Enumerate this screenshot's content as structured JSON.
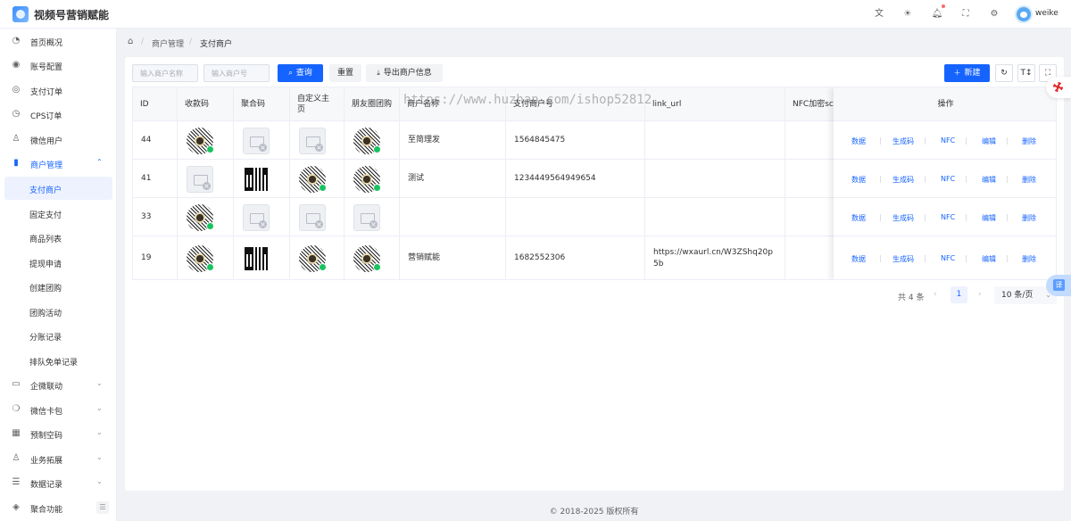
{
  "app": {
    "title": "视频号营销赋能"
  },
  "header": {
    "icons": [
      "translate-icon",
      "theme-icon",
      "bell-icon",
      "fullscreen-icon",
      "settings-icon"
    ],
    "username": "weike"
  },
  "sidebar": {
    "items": [
      {
        "label": "首页概况",
        "icon": "dashboard-icon"
      },
      {
        "label": "账号配置",
        "icon": "account-icon"
      },
      {
        "label": "支付订单",
        "icon": "payment-icon"
      },
      {
        "label": "CPS订单",
        "icon": "clock-icon"
      },
      {
        "label": "微信用户",
        "icon": "user-icon"
      },
      {
        "label": "商户管理",
        "icon": "chart-icon",
        "expanded": true
      }
    ],
    "sub_items": [
      {
        "label": "支付商户",
        "active": true
      },
      {
        "label": "固定支付"
      },
      {
        "label": "商品列表"
      },
      {
        "label": "提现申请"
      },
      {
        "label": "创建团购"
      },
      {
        "label": "团购活动"
      },
      {
        "label": "分账记录"
      },
      {
        "label": "排队免单记录"
      }
    ],
    "more_items": [
      {
        "label": "企微联动",
        "icon": "box-icon"
      },
      {
        "label": "微信卡包",
        "icon": "wechat-icon"
      },
      {
        "label": "预制空码",
        "icon": "qrcode-icon"
      },
      {
        "label": "业务拓展",
        "icon": "users-icon"
      },
      {
        "label": "数据记录",
        "icon": "list-icon"
      },
      {
        "label": "聚合功能",
        "icon": "grid-icon"
      }
    ]
  },
  "breadcrumb": {
    "home_icon": "home-icon",
    "level1": "商户管理",
    "level2": "支付商户",
    "separator": "/"
  },
  "toolbar": {
    "name_placeholder": "输入商户名称",
    "number_placeholder": "输入商户号",
    "search_label": "查询",
    "reset_label": "重置",
    "export_label": "导出商户信息",
    "new_label": "新建"
  },
  "table": {
    "headers": [
      "ID",
      "收款码",
      "聚合码",
      "自定义主页",
      "朋友圈团购",
      "商户名称",
      "支付商户号",
      "link_url",
      "NFC加密sc",
      "操作"
    ],
    "rows": [
      {
        "id": "44",
        "images": [
          "wechat",
          "broken",
          "broken",
          "wechat"
        ],
        "name": "至简理发",
        "mch_no": "1564845475",
        "link_url": ""
      },
      {
        "id": "41",
        "images": [
          "broken",
          "square",
          "wechat",
          "wechat"
        ],
        "name": "测试",
        "mch_no": "1234449564949654",
        "link_url": ""
      },
      {
        "id": "33",
        "images": [
          "wechat",
          "broken",
          "broken",
          "broken"
        ],
        "name": "",
        "mch_no": "",
        "link_url": ""
      },
      {
        "id": "19",
        "images": [
          "wechat",
          "square",
          "wechat",
          "wechat"
        ],
        "name": "营销赋能",
        "mch_no": "1682552306",
        "link_url": "https://wxaurl.cn/W3ZShq20p5b"
      }
    ],
    "actions": [
      "数据",
      "生成码",
      "NFC",
      "编辑",
      "删除"
    ]
  },
  "watermark": "https://www.huzhan.com/ishop52812",
  "pagination": {
    "total": "共 4 条",
    "current_page": "1",
    "page_size": "10 条/页"
  },
  "footer": {
    "text": "© 2018-2025 版权所有"
  },
  "colors": {
    "primary": "#1664ff",
    "background": "#f0f2f5"
  }
}
